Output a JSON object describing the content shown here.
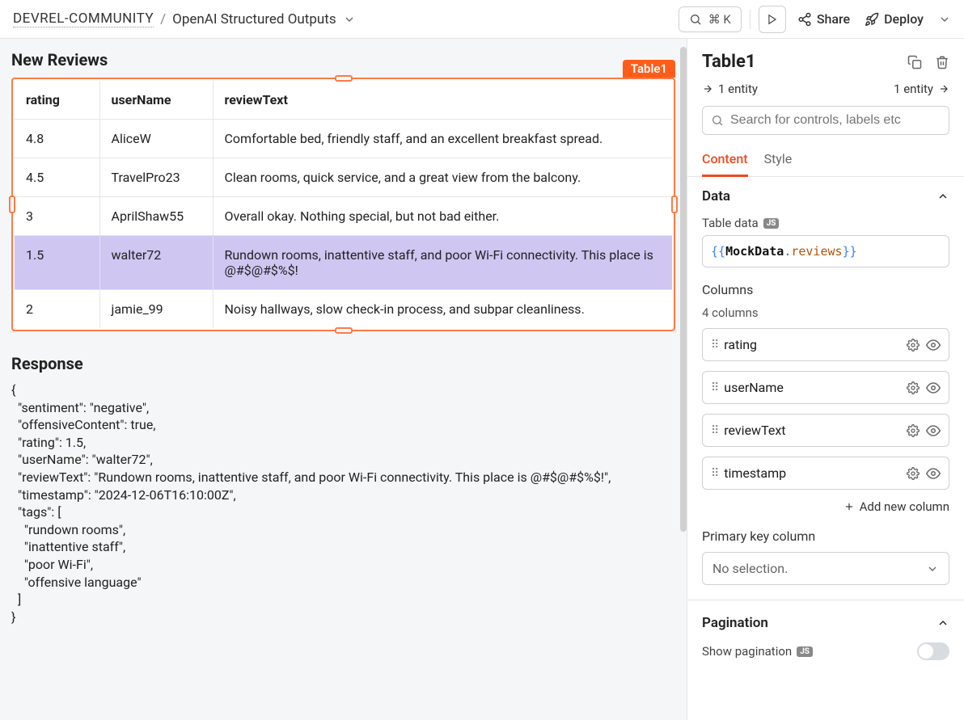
{
  "topbar": {
    "org": "DEVREL-COMMUNITY",
    "sep": "/",
    "app": "OpenAI Structured Outputs",
    "search_shortcut": "⌘ K",
    "share": "Share",
    "deploy": "Deploy"
  },
  "canvas": {
    "reviews_title": "New Reviews",
    "table_badge": "Table1",
    "table": {
      "headers": {
        "rating": "rating",
        "userName": "userName",
        "reviewText": "reviewText"
      },
      "rows": [
        {
          "rating": "4.8",
          "userName": "AliceW",
          "reviewText": "Comfortable bed, friendly staff, and an excellent breakfast spread.",
          "selected": false
        },
        {
          "rating": "4.5",
          "userName": "TravelPro23",
          "reviewText": "Clean rooms, quick service, and a great view from the balcony.",
          "selected": false
        },
        {
          "rating": "3",
          "userName": "AprilShaw55",
          "reviewText": "Overall okay. Nothing special, but not bad either.",
          "selected": false
        },
        {
          "rating": "1.5",
          "userName": "walter72",
          "reviewText": "Rundown rooms, inattentive staff, and poor Wi-Fi connectivity. This place is @#$@#$%$!",
          "selected": true
        },
        {
          "rating": "2",
          "userName": "jamie_99",
          "reviewText": "Noisy hallways, slow check-in process, and subpar cleanliness.",
          "selected": false
        }
      ]
    },
    "response_title": "Response",
    "response_body": "{\n  \"sentiment\": \"negative\",\n  \"offensiveContent\": true,\n  \"rating\": 1.5,\n  \"userName\": \"walter72\",\n  \"reviewText\": \"Rundown rooms, inattentive staff, and poor Wi-Fi connectivity. This place is @#$@#$%$!\",\n  \"timestamp\": \"2024-12-06T16:10:00Z\",\n  \"tags\": [\n    \"rundown rooms\",\n    \"inattentive staff\",\n    \"poor Wi-Fi\",\n    \"offensive language\"\n  ]\n}"
  },
  "inspector": {
    "title": "Table1",
    "entity_left": "1 entity",
    "entity_right": "1 entity",
    "search_placeholder": "Search for controls, labels etc",
    "tabs": {
      "content": "Content",
      "style": "Style"
    },
    "data": {
      "heading": "Data",
      "table_data_label": "Table data",
      "js_badge": "JS",
      "binding_open": "{{",
      "binding_obj": "MockData",
      "binding_dot": ".",
      "binding_prop": "reviews",
      "binding_close": "}}",
      "columns_label": "Columns",
      "columns_count": "4 columns",
      "columns": [
        {
          "name": "rating"
        },
        {
          "name": "userName"
        },
        {
          "name": "reviewText"
        },
        {
          "name": "timestamp"
        }
      ],
      "add_column": "Add new column",
      "primary_key_label": "Primary key column",
      "primary_key_value": "No selection."
    },
    "pagination": {
      "heading": "Pagination",
      "show_label": "Show pagination",
      "js_badge": "JS"
    }
  }
}
